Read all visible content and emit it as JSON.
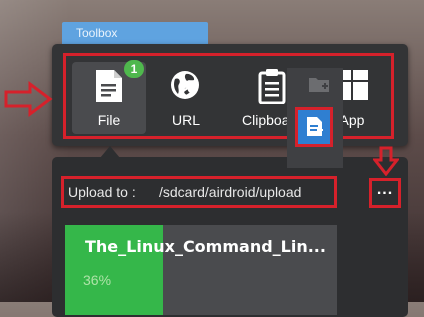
{
  "window": {
    "title": "Toolbox"
  },
  "toolbar": {
    "tools": [
      {
        "label": "File",
        "icon": "file-icon",
        "badge": "1",
        "selected": true
      },
      {
        "label": "URL",
        "icon": "globe-link-icon"
      },
      {
        "label": "Clipboard",
        "icon": "clipboard-icon"
      },
      {
        "label": "App",
        "icon": "app-icon"
      }
    ]
  },
  "upload": {
    "label": "Upload to :",
    "path": "/sdcard/airdroid/upload",
    "more_label": "..."
  },
  "file_item": {
    "name": "The_Linux_Command_Lin...",
    "progress_text": "36%",
    "progress": 0.36
  },
  "colors": {
    "accent_blue": "#5fa3e0",
    "highlight_red": "#d6212b",
    "progress_green": "#35b74a",
    "badge_green": "#4fb84d"
  }
}
